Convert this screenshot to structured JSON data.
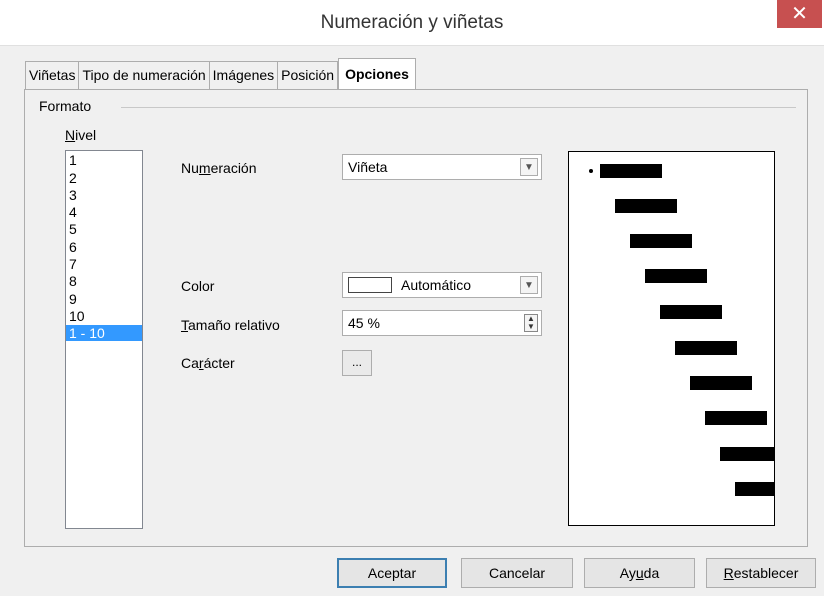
{
  "window": {
    "title": "Numeración y viñetas"
  },
  "tabs": [
    "Viñetas",
    "Tipo de numeración",
    "Imágenes",
    "Posición",
    "Opciones"
  ],
  "active_tab": "Opciones",
  "format": {
    "frame_label": "Formato",
    "level_label_u": "N",
    "level_label_rest": "ivel",
    "levels": [
      "1",
      "2",
      "3",
      "4",
      "5",
      "6",
      "7",
      "8",
      "9",
      "10",
      "1 - 10"
    ],
    "selected_level": "1 - 10",
    "numbering": {
      "label_pre": "Nu",
      "label_u": "m",
      "label_post": "eración",
      "value": "Viñeta"
    },
    "color": {
      "label": "Color",
      "value": "Automático"
    },
    "relative_size": {
      "label_u": "T",
      "label_rest": "amaño relativo",
      "value": "45 %"
    },
    "character": {
      "label_pre": "Ca",
      "label_u": "r",
      "label_post": "ácter",
      "button": "..."
    }
  },
  "buttons": {
    "ok": "Aceptar",
    "cancel": "Cancelar",
    "help_pre": "Ay",
    "help_u": "u",
    "help_post": "da",
    "reset_u": "R",
    "reset_rest": "establecer"
  }
}
